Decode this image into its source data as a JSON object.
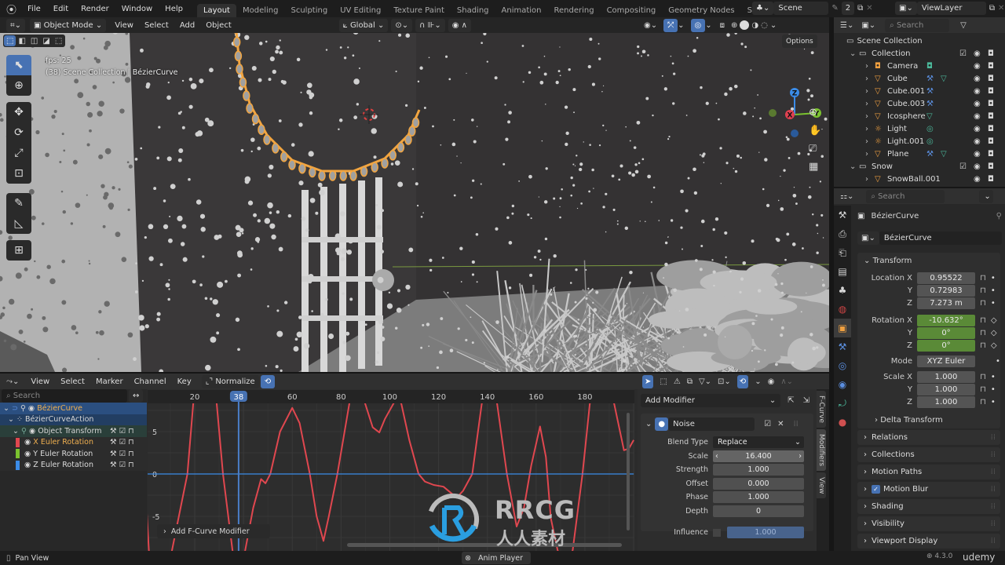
{
  "menu": [
    "File",
    "Edit",
    "Render",
    "Window",
    "Help"
  ],
  "workspaces": [
    "Layout",
    "Modeling",
    "Sculpting",
    "UV Editing",
    "Texture Paint",
    "Shading",
    "Animation",
    "Rendering",
    "Compositing",
    "Geometry Nodes",
    "Scripting"
  ],
  "active_workspace": "Layout",
  "scene": {
    "name": "Scene",
    "users": "2"
  },
  "view_layer": "ViewLayer",
  "viewport": {
    "mode": "Object Mode",
    "menus": [
      "View",
      "Select",
      "Add",
      "Object"
    ],
    "orientation": "Global",
    "options": "Options",
    "fps": "fps: 25",
    "info": "(38) Scene Collection",
    "separator": "|",
    "object": "BézierCurve",
    "gizmo": {
      "x": "X",
      "y": "Y",
      "z": "Z"
    }
  },
  "outliner": {
    "search_placeholder": "Search",
    "root": "Scene Collection",
    "items": [
      {
        "name": "Collection",
        "type": "collection",
        "level": 0
      },
      {
        "name": "Camera",
        "type": "camera",
        "level": 1,
        "extras": [
          "camera-data"
        ]
      },
      {
        "name": "Cube",
        "type": "mesh",
        "level": 1,
        "extras": [
          "modifier",
          "mesh-data"
        ]
      },
      {
        "name": "Cube.001",
        "type": "mesh",
        "level": 1,
        "extras": [
          "modifier"
        ]
      },
      {
        "name": "Cube.003",
        "type": "mesh",
        "level": 1,
        "extras": [
          "modifier"
        ]
      },
      {
        "name": "Icosphere",
        "type": "mesh",
        "level": 1,
        "extras": [
          "mesh-data"
        ]
      },
      {
        "name": "Light",
        "type": "light",
        "level": 1,
        "extras": [
          "light-data"
        ]
      },
      {
        "name": "Light.001",
        "type": "light",
        "level": 1,
        "extras": [
          "light-data"
        ]
      },
      {
        "name": "Plane",
        "type": "mesh",
        "level": 1,
        "extras": [
          "modifier",
          "mesh-data"
        ]
      },
      {
        "name": "Snow",
        "type": "collection",
        "level": 0
      },
      {
        "name": "SnowBall.001",
        "type": "mesh",
        "level": 1,
        "extras": []
      }
    ]
  },
  "properties": {
    "search_placeholder": "Search",
    "object": "BézierCurve",
    "datablock": "BézierCurve",
    "transform": {
      "title": "Transform",
      "location": {
        "label": "Location X",
        "x": "0.95522",
        "y": "0.72983",
        "z": "7.273 m"
      },
      "rotation": {
        "label": "Rotation X",
        "x": "-10.632°",
        "y": "0°",
        "z": "0°"
      },
      "mode": {
        "label": "Mode",
        "value": "XYZ Euler"
      },
      "scale": {
        "label": "Scale X",
        "x": "1.000",
        "y": "1.000",
        "z": "1.000"
      },
      "axis": {
        "y": "Y",
        "z": "Z"
      },
      "delta": "Delta Transform"
    },
    "panels": [
      "Relations",
      "Collections",
      "Motion Paths",
      "Motion Blur",
      "Shading",
      "Visibility",
      "Viewport Display"
    ],
    "motion_blur_checked": true
  },
  "graph": {
    "menus": [
      "View",
      "Select",
      "Marker",
      "Channel",
      "Key"
    ],
    "normalize": "Normalize",
    "search_placeholder": "Search",
    "channels": {
      "object": "BézierCurve",
      "action": "BézierCurveAction",
      "group": "Object Transform",
      "x": "X Euler Rotation",
      "y": "Y Euler Rotation",
      "z": "Z Euler Rotation"
    },
    "channel_colors": {
      "x": "#e0474f",
      "y": "#7bc22f",
      "z": "#3b8ce8"
    },
    "current_frame": "38",
    "add_fcurve_modifier": "Add F-Curve Modifier",
    "modifier": {
      "add": "Add Modifier",
      "name": "Noise",
      "blend_type_label": "Blend Type",
      "blend_type": "Replace",
      "scale_label": "Scale",
      "scale": "16.400",
      "strength_label": "Strength",
      "strength": "1.000",
      "offset_label": "Offset",
      "offset": "0.000",
      "phase_label": "Phase",
      "phase": "1.000",
      "depth_label": "Depth",
      "depth": "0",
      "influence_label": "Influence",
      "influence": "1.000"
    },
    "tabs": [
      "F-Curve",
      "Modifiers",
      "View"
    ]
  },
  "chart_data": {
    "type": "line",
    "x_ticks": [
      "20",
      "38",
      "60",
      "80",
      "100",
      "120",
      "140",
      "160",
      "180"
    ],
    "y_ticks": [
      "5",
      "0",
      "-5"
    ],
    "xlim": [
      -5,
      200
    ],
    "ylim": [
      -9.2,
      8.3
    ],
    "series": [
      {
        "name": "X Euler Rotation",
        "color": "#e0474f",
        "points": [
          [
            -1,
            -1
          ],
          [
            0,
            -2.8
          ],
          [
            1.2,
            -9
          ],
          [
            4,
            -14
          ],
          [
            10,
            -10
          ],
          [
            17,
            0
          ],
          [
            19.4,
            8.3
          ],
          [
            22,
            13
          ],
          [
            26,
            13
          ],
          [
            29,
            8.3
          ],
          [
            31.6,
            0
          ],
          [
            35.5,
            -9
          ],
          [
            38,
            -12
          ],
          [
            40.7,
            -9
          ],
          [
            44,
            -4
          ],
          [
            47.2,
            -0.6
          ],
          [
            49,
            -1.1
          ],
          [
            51,
            0
          ],
          [
            55,
            5
          ],
          [
            60,
            7.8
          ],
          [
            63,
            6
          ],
          [
            67.2,
            0
          ],
          [
            70,
            -5
          ],
          [
            72.8,
            -7.9
          ],
          [
            75,
            -5
          ],
          [
            78.5,
            0
          ],
          [
            83.4,
            8.3
          ],
          [
            86,
            11
          ],
          [
            89.9,
            8.3
          ],
          [
            93,
            5.5
          ],
          [
            95.7,
            4.9
          ],
          [
            98,
            6.5
          ],
          [
            101.5,
            8.3
          ],
          [
            103,
            9
          ],
          [
            104.7,
            8.3
          ],
          [
            108,
            4
          ],
          [
            111.8,
            0
          ],
          [
            114.4,
            -0.9
          ],
          [
            118,
            -1.3
          ],
          [
            122,
            -1.5
          ],
          [
            127.4,
            -2.8
          ],
          [
            130,
            -2
          ],
          [
            133.8,
            0
          ],
          [
            137.7,
            8.3
          ],
          [
            141,
            11
          ],
          [
            144,
            8.3
          ],
          [
            148,
            0
          ],
          [
            152,
            -6.2
          ],
          [
            155,
            -4
          ],
          [
            158,
            1
          ],
          [
            161.6,
            5.6
          ],
          [
            164,
            2
          ],
          [
            166,
            -5.2
          ],
          [
            168.8,
            -9
          ],
          [
            172,
            -11
          ],
          [
            175,
            -9
          ],
          [
            179,
            0
          ],
          [
            182,
            8.3
          ],
          [
            187,
            11
          ],
          [
            192,
            8.3
          ],
          [
            196,
            2.8
          ],
          [
            198,
            3
          ],
          [
            200,
            4
          ]
        ]
      },
      {
        "name": "Z Euler Rotation",
        "color": "#3b8ce8",
        "points": [
          [
            -5,
            0
          ],
          [
            200,
            0
          ]
        ]
      }
    ]
  },
  "status": {
    "left": "Pan View",
    "center": "Anim Player",
    "version": "4.3.0"
  },
  "watermark": {
    "logo": "RRCG",
    "sub": "人人素材",
    "brand": "udemy"
  },
  "colors": {
    "accent": "#4772b3",
    "selected_object": "#f0a040",
    "keyed_field": "#5a8a37"
  }
}
